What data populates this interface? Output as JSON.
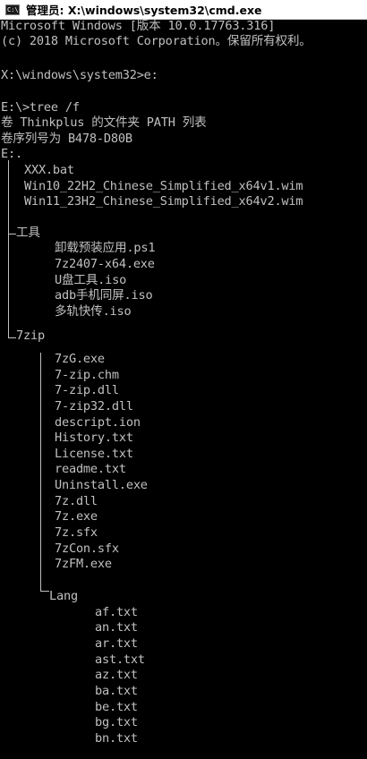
{
  "window": {
    "title": "管理员: X:\\windows\\system32\\cmd.exe"
  },
  "header": {
    "line1": "Microsoft Windows [版本 10.0.17763.316]",
    "line2": "(c) 2018 Microsoft Corporation。保留所有权利。"
  },
  "commands": {
    "prompt1": "X:\\windows\\system32>e:",
    "prompt2": "E:\\>tree /f"
  },
  "tree_header": {
    "volume": "卷 Thinkplus 的文件夹 PATH 列表",
    "serial": "卷序列号为 B478-D80B",
    "root": "E:."
  },
  "root_files": [
    "XXX.bat",
    "Win10_22H2_Chinese_Simplified_x64v1.wim",
    "Win11_23H2_Chinese_Simplified_x64v2.wim"
  ],
  "folder_tools": {
    "name": "工具",
    "files": [
      "卸载预装应用.ps1",
      "7z2407-x64.exe",
      "U盘工具.iso",
      "adb手机同屏.iso",
      "多轨快传.iso"
    ]
  },
  "folder_7zip": {
    "name": "7zip",
    "files": [
      "7zG.exe",
      "7-zip.chm",
      "7-zip.dll",
      "7-zip32.dll",
      "descript.ion",
      "History.txt",
      "License.txt",
      "readme.txt",
      "Uninstall.exe",
      "7z.dll",
      "7z.exe",
      "7z.sfx",
      "7zCon.sfx",
      "7zFM.exe"
    ]
  },
  "folder_lang": {
    "name": "Lang",
    "files": [
      "af.txt",
      "an.txt",
      "ar.txt",
      "ast.txt",
      "az.txt",
      "ba.txt",
      "be.txt",
      "bg.txt",
      "bn.txt"
    ]
  },
  "colors": {
    "background": "#000000",
    "text": "#c0c0c0",
    "titlebar": "#ffffff"
  },
  "icons": {
    "app": "cmd-console-icon"
  }
}
